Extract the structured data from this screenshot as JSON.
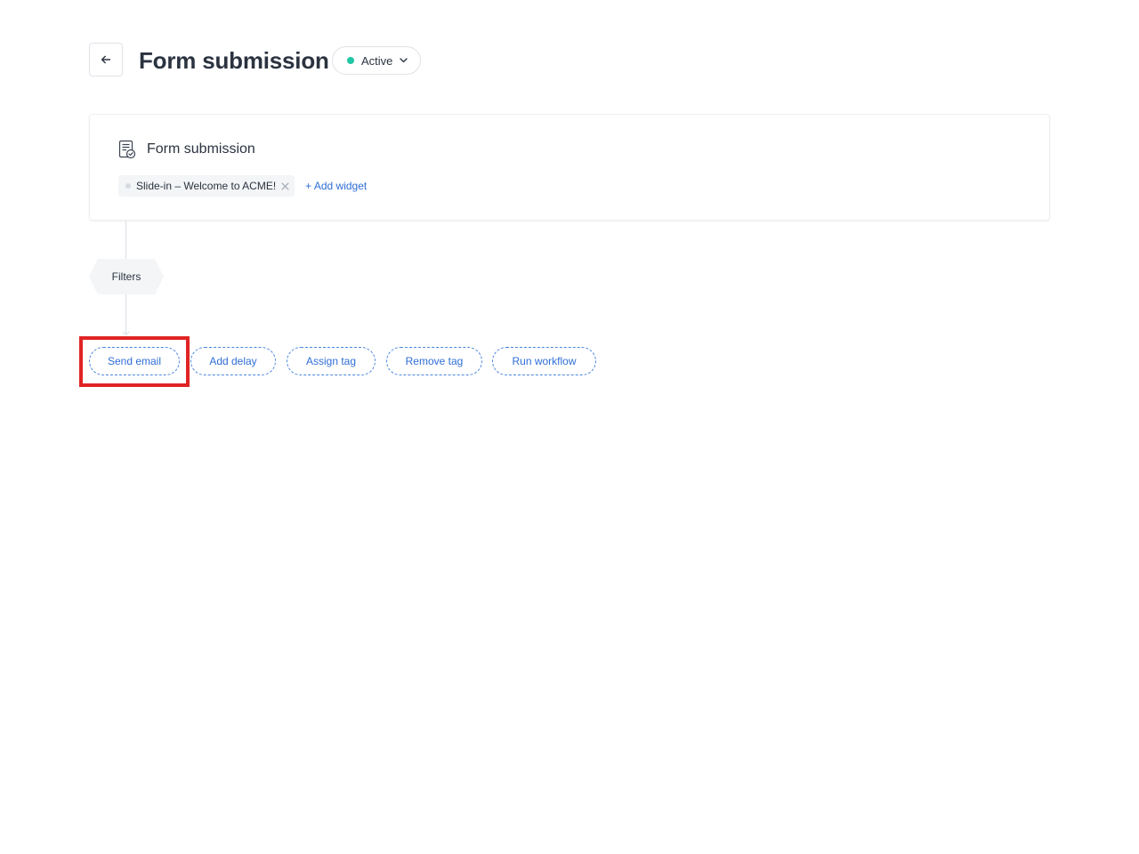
{
  "header": {
    "back_icon": "arrow-left-icon",
    "title": "Form submission",
    "status": {
      "label": "Active",
      "dot_color": "#20c7a6",
      "chevron_icon": "chevron-down-icon"
    }
  },
  "trigger": {
    "icon": "form-document-check-icon",
    "title": "Form submission",
    "widgets": [
      {
        "label": "Slide-in – Welcome to ACME!",
        "remove_icon": "close-icon"
      }
    ],
    "add_widget_label": "+ Add widget"
  },
  "filters": {
    "label": "Filters"
  },
  "actions": [
    {
      "label": "Send email",
      "highlighted": true
    },
    {
      "label": "Add delay"
    },
    {
      "label": "Assign tag"
    },
    {
      "label": "Remove tag"
    },
    {
      "label": "Run workflow"
    }
  ],
  "colors": {
    "accent": "#2f6ed6",
    "status_active": "#20c7a6",
    "highlight": "#e02424"
  }
}
